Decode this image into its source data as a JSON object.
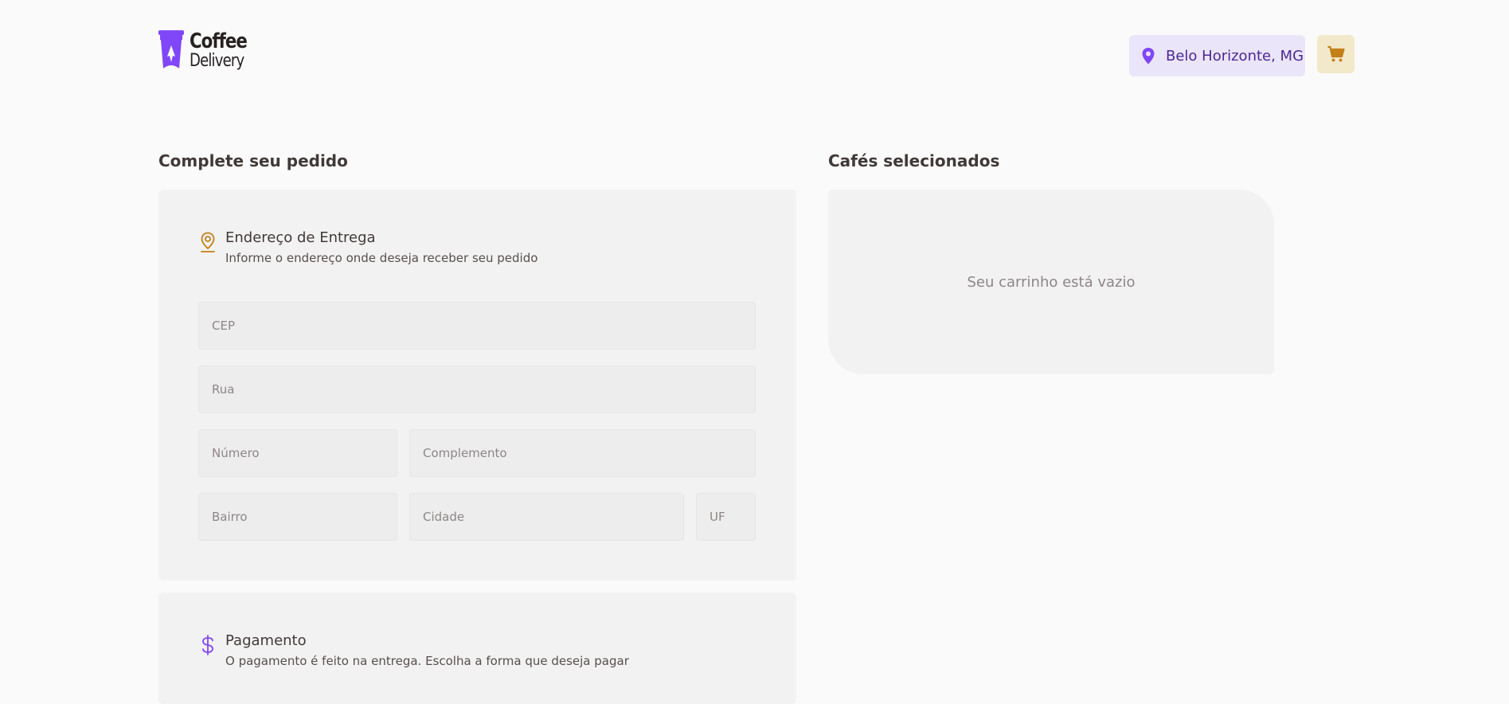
{
  "header": {
    "logo_line1": "Coffee",
    "logo_line2": "Delivery",
    "location": "Belo Horizonte, MG",
    "location_icon": "map-pin-icon",
    "cart_icon": "shopping-cart-icon"
  },
  "order": {
    "title": "Complete seu pedido",
    "address": {
      "title": "Endereço de Entrega",
      "subtitle": "Informe o endereço onde deseja receber seu pedido",
      "icon": "map-pin-outline-icon",
      "fields": {
        "cep": "CEP",
        "rua": "Rua",
        "numero": "Número",
        "complemento": "Complemento",
        "bairro": "Bairro",
        "cidade": "Cidade",
        "uf": "UF"
      }
    },
    "payment": {
      "title": "Pagamento",
      "subtitle": "O pagamento é feito na entrega. Escolha a forma que deseja pagar",
      "icon": "currency-dollar-icon"
    }
  },
  "cart": {
    "title": "Cafés selecionados",
    "empty_message": "Seu carrinho está vazio"
  },
  "colors": {
    "background": "#fafafa",
    "card": "#f3f2f2",
    "input": "#eeeded",
    "purple": "#8047f8",
    "purple_dark": "#4b2995",
    "purple_light": "#ebe5f9",
    "yellow": "#dbac2c",
    "yellow_dark": "#c47f17",
    "yellow_light": "#f1e9c9"
  }
}
